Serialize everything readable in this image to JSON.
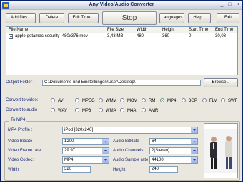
{
  "window": {
    "title": "Any Video/Audio Converter"
  },
  "toolbar": {
    "add_files": "Add files...",
    "delete": "Delete",
    "edit_time": "Edit Time...",
    "stop": "Stop",
    "languages": "Languages",
    "help": "Help...",
    "exit": "Exit"
  },
  "table": {
    "columns": [
      "File Name",
      "File Size",
      "Width",
      "Height",
      "Start Time",
      "End Time"
    ],
    "rows": [
      {
        "name": "apple-getamac-security_480x376.mov",
        "size": "3,43 MB",
        "width": "480",
        "height": "360",
        "start": "0",
        "end": "30,03"
      }
    ]
  },
  "output": {
    "label": "Output Folder :",
    "path": "C:\\Dokumente und Einstellungen\\User\\Desktop\\",
    "browse": "Browse..."
  },
  "convert_video": {
    "label": "Convert to video:",
    "options": [
      "AVI",
      "MPEG",
      "WMV",
      "MOV",
      "RM",
      "MP4",
      "3GP",
      "FLV",
      "SWF"
    ],
    "selected": "MP4"
  },
  "convert_audio": {
    "label": "Convert to audio :",
    "options": [
      "WAV",
      "MP3",
      "WMA",
      "M4A",
      "AMR"
    ]
  },
  "settings": {
    "group_title": "To MP4",
    "profile_label": "MP4 Profile :",
    "profile_value": "iPod [320x240]",
    "video_bitrate_label": "Video Bitrate",
    "video_bitrate": "1200",
    "frame_rate_label": "Video Frame rate:",
    "frame_rate": "29.97",
    "codec_label": "Video Codec:",
    "codec": "MP4",
    "width_label": "Width",
    "width": "320",
    "audio_bitrate_label": "Audio BitRate",
    "audio_bitrate": "64",
    "audio_channels_label": "Audio Channels",
    "audio_channels": "2(Stereo)",
    "sample_rate_label": "Audio Sample rate",
    "sample_rate": "44100",
    "height_label": "Height",
    "height": "240"
  }
}
